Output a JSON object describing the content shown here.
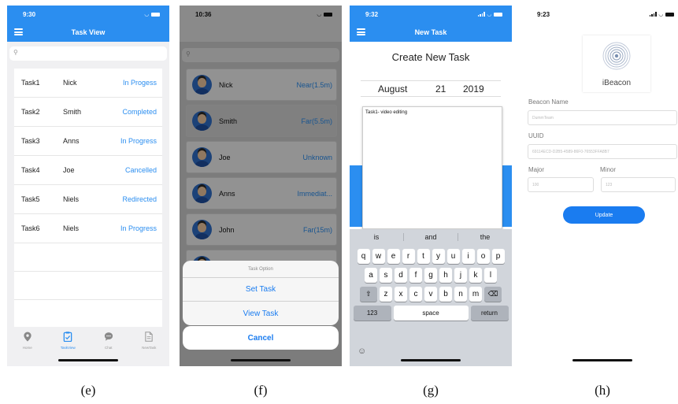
{
  "captions": [
    "(e)",
    "(f)",
    "(g)",
    "(h)"
  ],
  "screen_e": {
    "time": "9:30",
    "nav_title": "Task View",
    "tasks": [
      {
        "task": "Task1",
        "name": "Nick",
        "status": "In Progess"
      },
      {
        "task": "Task2",
        "name": "Smith",
        "status": "Completed"
      },
      {
        "task": "Task3",
        "name": "Anns",
        "status": "In Progress"
      },
      {
        "task": "Task4",
        "name": "Joe",
        "status": "Cancelled"
      },
      {
        "task": "Task5",
        "name": "Niels",
        "status": "Redirected"
      },
      {
        "task": "Task6",
        "name": "Niels",
        "status": "In Progress"
      }
    ],
    "tabs": [
      {
        "label": "Home",
        "icon": "location-pin-icon"
      },
      {
        "label": "TaskView",
        "icon": "clipboard-icon"
      },
      {
        "label": "Chat",
        "icon": "chat-bubble-icon"
      },
      {
        "label": "NewTask",
        "icon": "document-icon"
      }
    ]
  },
  "screen_f": {
    "time": "10:36",
    "contacts": [
      {
        "name": "Nick",
        "distance": "Near(1.5m)"
      },
      {
        "name": "Smith",
        "distance": "Far(5.5m)"
      },
      {
        "name": "Joe",
        "distance": "Unknown"
      },
      {
        "name": "Anns",
        "distance": "Immediat..."
      },
      {
        "name": "John",
        "distance": "Far(15m)"
      }
    ],
    "sheet_title": "Task Option",
    "sheet_options": [
      "Set Task",
      "View Task"
    ],
    "cancel_label": "Cancel"
  },
  "screen_g": {
    "time": "9:32",
    "nav_title": "New Task",
    "title": "Create New Task",
    "date": {
      "month": "August",
      "day": "21",
      "year": "2019"
    },
    "description": "Task1- video editing",
    "suggestions": [
      "is",
      "and",
      "the"
    ],
    "keys_row1": [
      "q",
      "w",
      "e",
      "r",
      "t",
      "y",
      "u",
      "i",
      "o",
      "p"
    ],
    "keys_row2": [
      "a",
      "s",
      "d",
      "f",
      "g",
      "h",
      "j",
      "k",
      "l"
    ],
    "keys_row3": [
      "z",
      "x",
      "c",
      "v",
      "b",
      "n",
      "m"
    ],
    "num_key": "123",
    "space_key": "space",
    "return_key": "return"
  },
  "screen_h": {
    "time": "9:23",
    "logo_text": "iBeacon",
    "beacon_name_label": "Beacon Name",
    "beacon_name_placeholder": "DummTeam",
    "uuid_label": "UUID",
    "uuid_placeholder": "69114ECD-D2B5-4589-86F0-76553FFA8B7",
    "major_label": "Major",
    "minor_label": "Minor",
    "major_placeholder": "100",
    "minor_placeholder": "123",
    "update_label": "Update"
  },
  "colors": {
    "accent": "#2b8ef0",
    "link": "#1a7cf0",
    "background": "#f0f0f2"
  }
}
